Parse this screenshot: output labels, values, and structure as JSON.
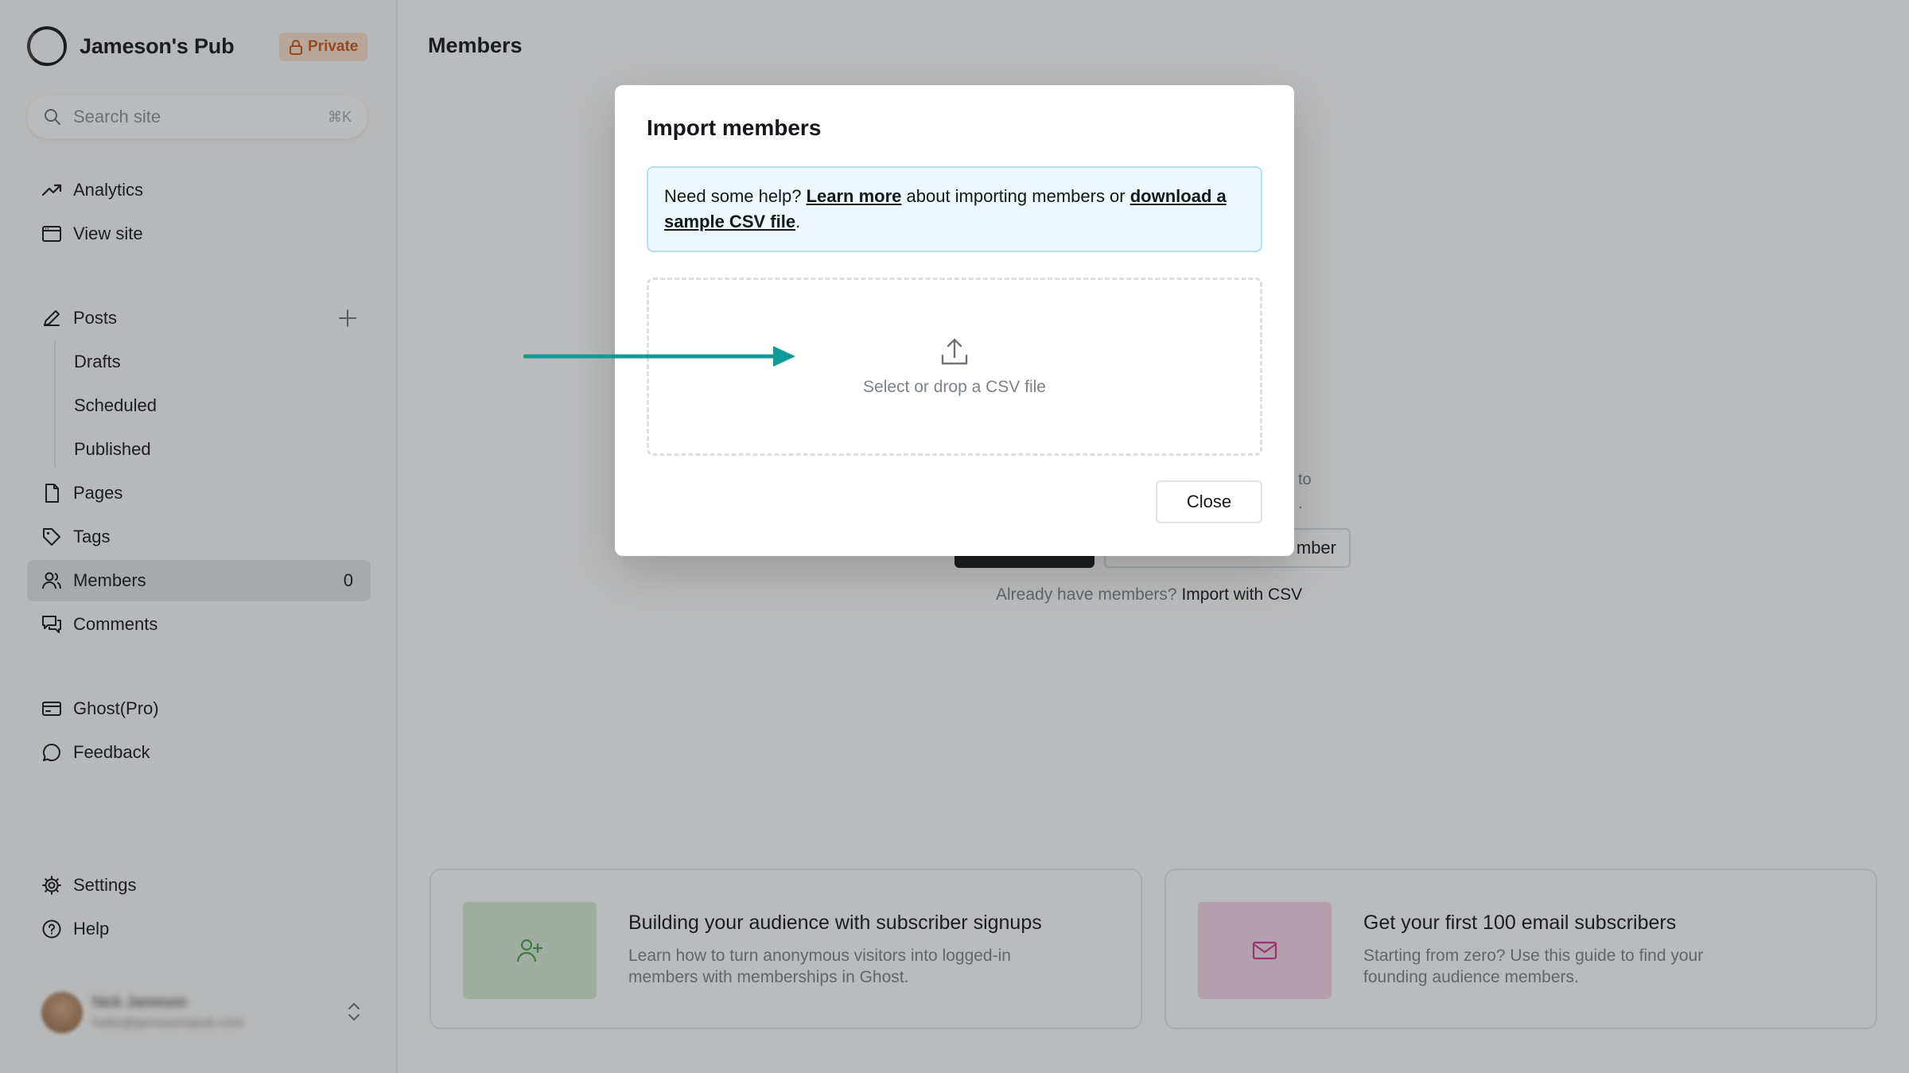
{
  "sidebar": {
    "site_name": "Jameson's Pub",
    "privacy_badge": "Private",
    "search": {
      "placeholder": "Search site",
      "shortcut": "⌘K"
    },
    "nav_top": [
      {
        "label": "Analytics",
        "icon": "trend-icon"
      },
      {
        "label": "View site",
        "icon": "browser-icon"
      }
    ],
    "posts": {
      "label": "Posts",
      "icon": "pen-icon",
      "sub_items": [
        "Drafts",
        "Scheduled",
        "Published"
      ]
    },
    "nav_content": [
      {
        "label": "Pages",
        "icon": "page-icon"
      },
      {
        "label": "Tags",
        "icon": "tag-icon"
      },
      {
        "label": "Members",
        "icon": "members-icon",
        "count": "0",
        "active": true
      },
      {
        "label": "Comments",
        "icon": "comments-icon"
      }
    ],
    "nav_extra": [
      {
        "label": "Ghost(Pro)",
        "icon": "card-icon"
      },
      {
        "label": "Feedback",
        "icon": "chat-icon"
      }
    ],
    "nav_bottom": [
      {
        "label": "Settings",
        "icon": "gear-icon"
      },
      {
        "label": "Help",
        "icon": "help-icon"
      }
    ],
    "user": {
      "name": "Nick Jameson",
      "email": "hello@jamesonspub.com"
    }
  },
  "main": {
    "page_title": "Members",
    "empty_state": {
      "partial_text_line1": "to",
      "partial_text_line2": ".",
      "add_member_partial": "mber",
      "already_have": "Already have members?",
      "import_link": "Import with CSV"
    },
    "cards": [
      {
        "title": "Building your audience with subscriber signups",
        "description": "Learn how to turn anonymous visitors into logged-in members with memberships in Ghost.",
        "icon": "user-plus-icon",
        "thumb_color": "#d9ecd9"
      },
      {
        "title": "Get your first 100 email subscribers",
        "description": "Starting from zero? Use this guide to find your founding audience members.",
        "icon": "envelope-icon",
        "thumb_color": "#f5d7e8"
      }
    ]
  },
  "modal": {
    "title": "Import members",
    "help": {
      "prefix": "Need some help? ",
      "learn_more": "Learn more",
      "middle": " about importing members or ",
      "download_link": "download a sample CSV file",
      "suffix": "."
    },
    "dropzone_label": "Select or drop a CSV file",
    "close_label": "Close"
  },
  "colors": {
    "annotation_arrow": "#139b99",
    "private_badge_bg": "#fbe2cf",
    "private_badge_text": "#c8571b",
    "help_box_bg": "#edf7fd",
    "help_box_border": "#b5e1f7"
  }
}
